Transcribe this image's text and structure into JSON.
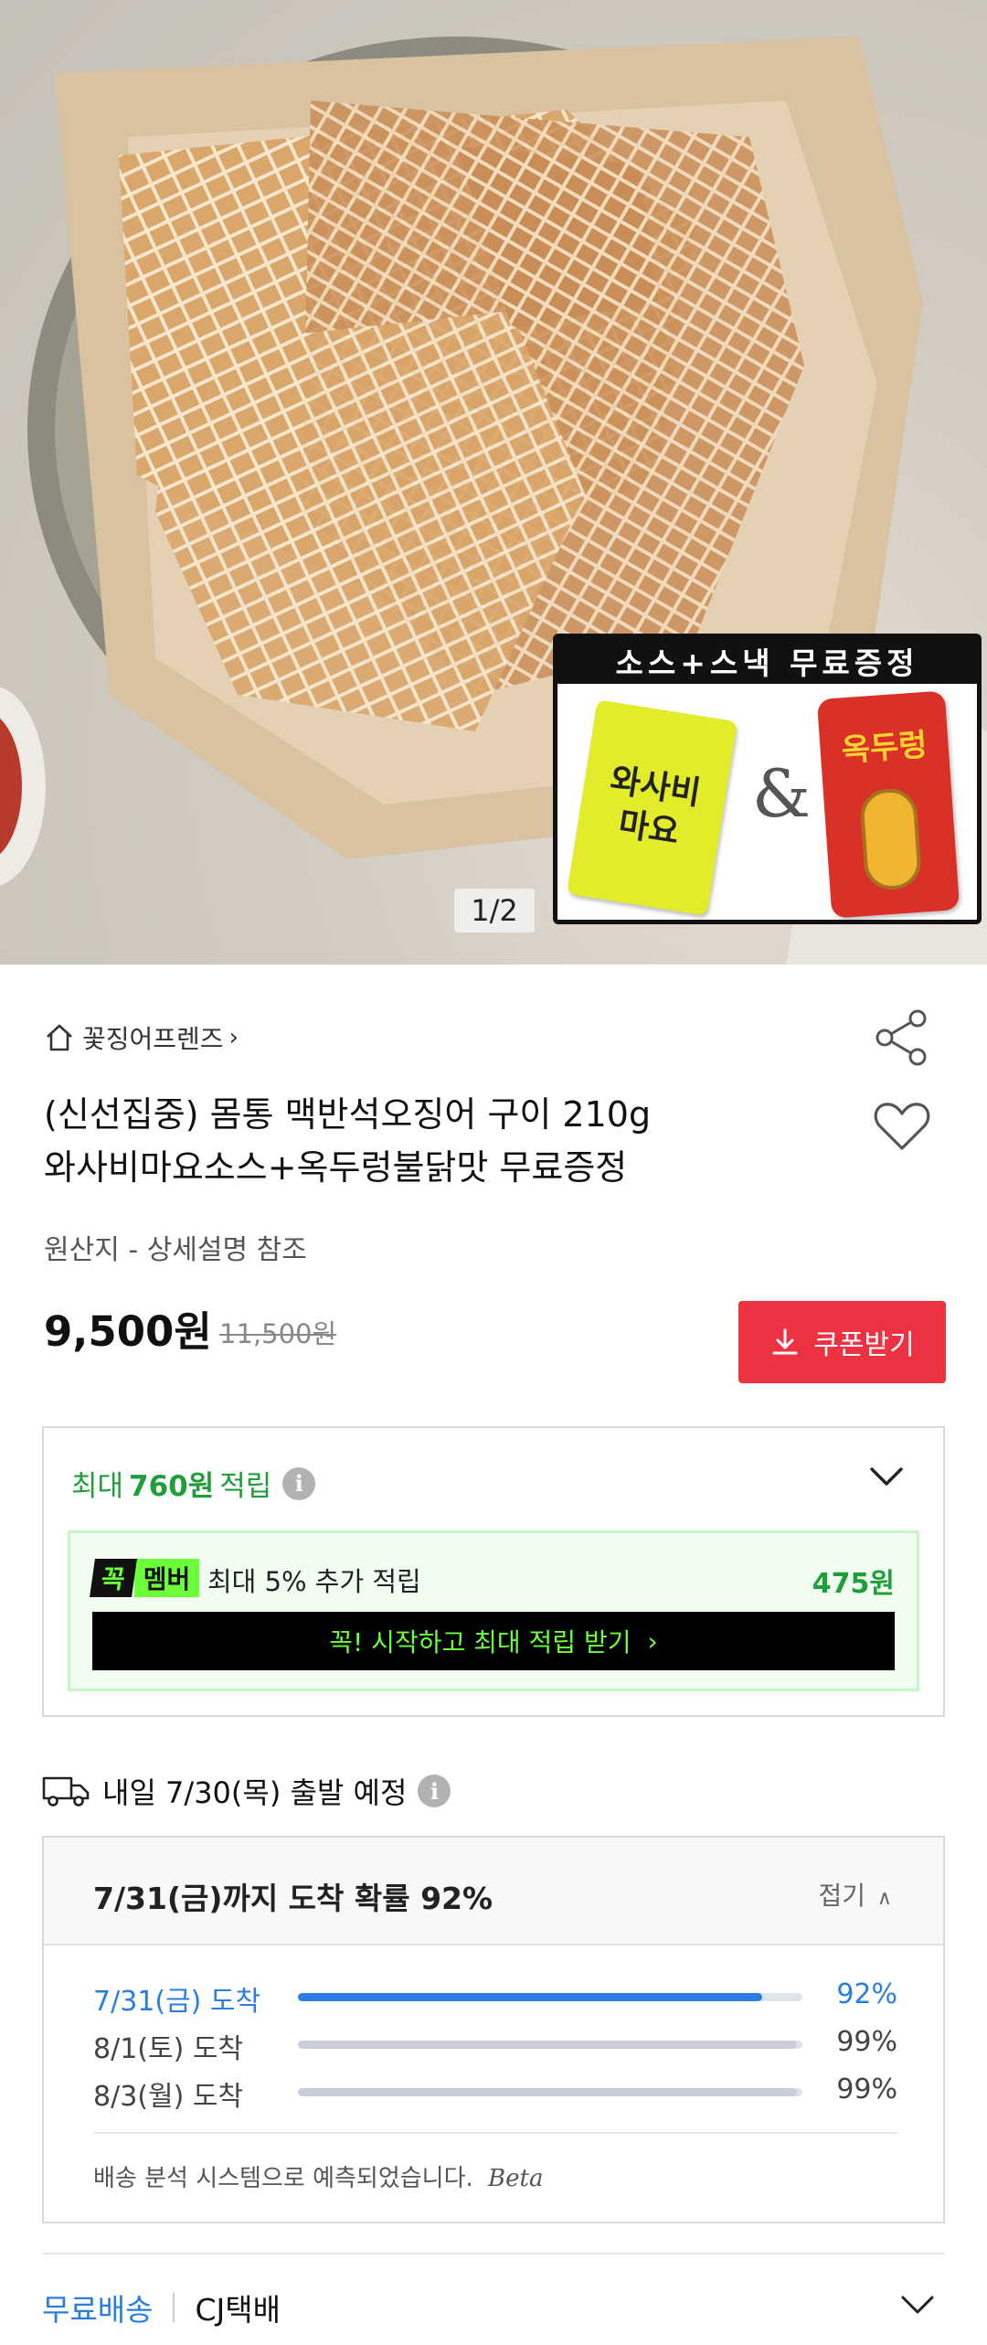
{
  "hero": {
    "counter": "1/2",
    "promo_header": "소스+스낵 무료증정",
    "sauce_label_line1": "와사비",
    "sauce_label_line2": "마요",
    "ampersand": "&",
    "snack_label": "옥두렁"
  },
  "store": {
    "name": "꽃징어프렌즈"
  },
  "product": {
    "title_line1": "(신선집중) 몸통 맥반석오징어 구이 210g",
    "title_line2": "와사비마요소스+옥두렁불닭맛 무료증정",
    "origin": "원산지 - 상세설명 참조",
    "price": "9,500원",
    "original_price": "11,500원",
    "coupon_label": "쿠폰받기"
  },
  "reward": {
    "prefix": "최대",
    "amount": "760원",
    "suffix": "적립",
    "member_badge_1": "꼭",
    "member_badge_2": "멤버",
    "member_text": "최대 5% 추가 적립",
    "member_amount": "475원",
    "member_cta": "꼭! 시작하고 최대 적립 받기"
  },
  "shipping": {
    "departure": "내일 7/30(목) 출발 예정",
    "eta_title": "7/31(금)까지 도착 확률 92%",
    "fold_label": "접기",
    "rows": [
      {
        "label": "7/31(금) 도착",
        "pct": "92%",
        "value": 0.92
      },
      {
        "label": "8/1(토) 도착",
        "pct": "99%",
        "value": 0.99
      },
      {
        "label": "8/3(월) 도착",
        "pct": "99%",
        "value": 0.99
      }
    ],
    "note": "배송 분석 시스템으로 예측되었습니다.",
    "note_beta": "Beta",
    "free_label": "무료배송",
    "carrier": "CJ택배"
  },
  "colors": {
    "accent_red": "#ed3241",
    "green": "#1f9e3a",
    "blue": "#2b7de0",
    "neon": "#6dff39"
  }
}
